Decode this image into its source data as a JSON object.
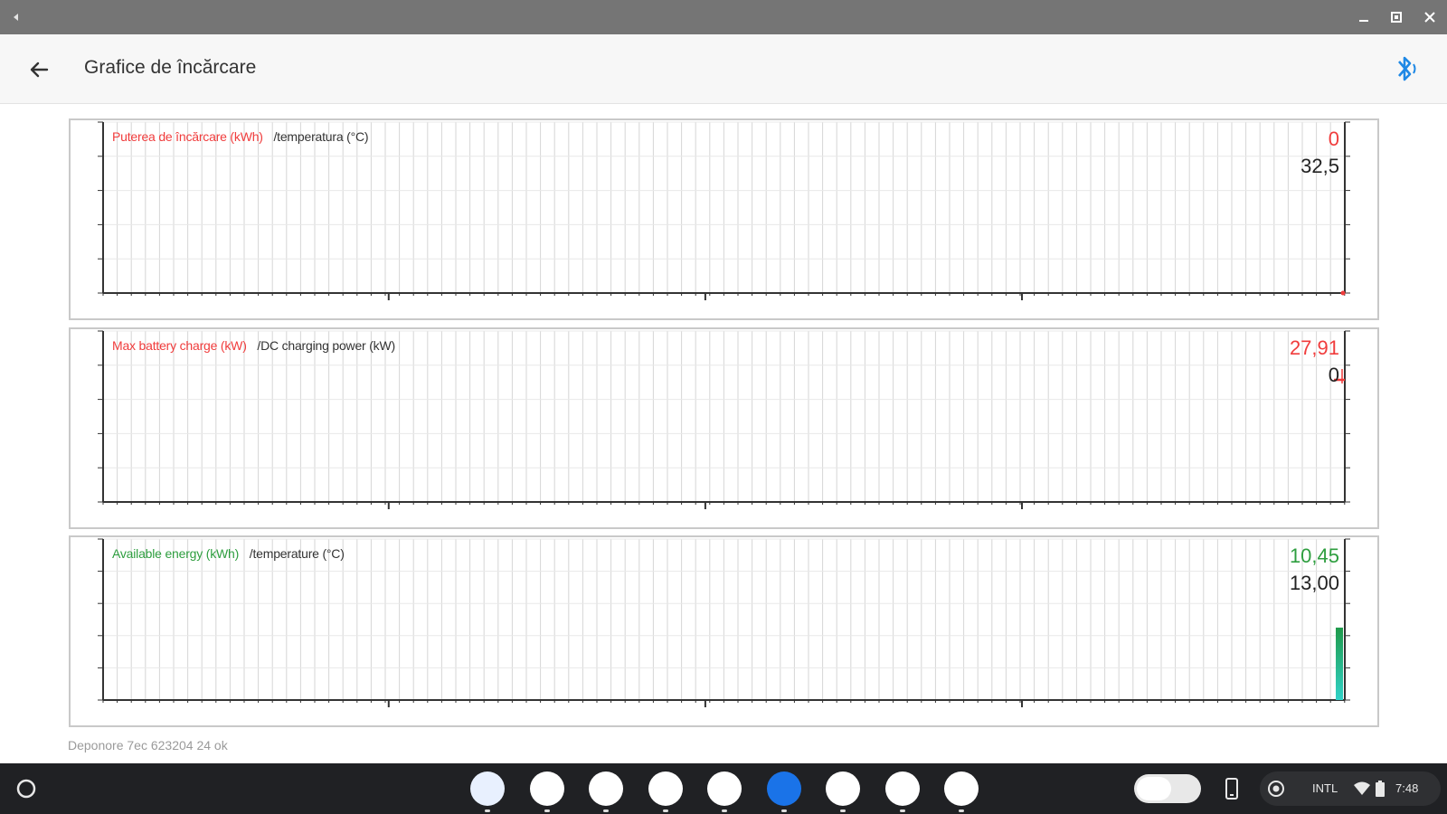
{
  "window": {
    "controls": [
      "minimize",
      "maximize",
      "close"
    ]
  },
  "appbar": {
    "title": "Grafice de încărcare",
    "back_icon": "arrow-left-icon",
    "status_icon": "bluetooth-icon"
  },
  "colors": {
    "red": "#f03c3c",
    "green": "#2e9e3f",
    "dark": "#222222",
    "grid": "#d6d6d6",
    "bar_green": "#1f9a4a",
    "bar_teal": "#30d2c8"
  },
  "charts": [
    {
      "legend_primary": "Puterea de încărcare (kWh)",
      "legend_secondary": "/temperatura (°C)",
      "primary_color": "#f03c3c",
      "value_primary": "0",
      "value_secondary": "32,5"
    },
    {
      "legend_primary": "Max battery charge (kW)",
      "legend_secondary": "/DC charging power (kW)",
      "primary_color": "#f03c3c",
      "value_primary": "27,91",
      "value_secondary": "0"
    },
    {
      "legend_primary": "Available energy (kWh)",
      "legend_secondary": "/temperature (°C)",
      "primary_color": "#2e9e3f",
      "value_primary": "10,45",
      "value_secondary": "13,00"
    }
  ],
  "chart_data": [
    {
      "type": "line",
      "series": [
        {
          "name": "Puterea de încărcare (kWh)",
          "last": 0
        },
        {
          "name": "temperatura (°C)",
          "last": 32.5
        }
      ]
    },
    {
      "type": "line",
      "series": [
        {
          "name": "Max battery charge (kW)",
          "last": 27.91
        },
        {
          "name": "DC charging power (kW)",
          "last": 0
        }
      ]
    },
    {
      "type": "bar",
      "series": [
        {
          "name": "Available energy (kWh)",
          "last": 10.45
        },
        {
          "name": "temperature (°C)",
          "last": 13.0
        }
      ],
      "bar_level_fraction": 0.45
    }
  ],
  "footer": {
    "text": "Deponore 7ec 623204 24 ok"
  },
  "shelf": {
    "apps": [
      {
        "name": "files-app-icon",
        "color": "#e8f0fe"
      },
      {
        "name": "chrome-icon",
        "color": "#ffffff"
      },
      {
        "name": "teams-icon",
        "color": "#ffffff"
      },
      {
        "name": "play-store-icon",
        "color": "#ffffff"
      },
      {
        "name": "whatsapp-icon",
        "color": "#ffffff"
      },
      {
        "name": "home-app-icon",
        "color": "#1a73e8"
      },
      {
        "name": "messages-icon",
        "color": "#ffffff"
      },
      {
        "name": "gmail-icon",
        "color": "#ffffff"
      },
      {
        "name": "docs-icon",
        "color": "#ffffff"
      }
    ],
    "status": {
      "keyboard": "INTL",
      "time": "7:48"
    }
  }
}
